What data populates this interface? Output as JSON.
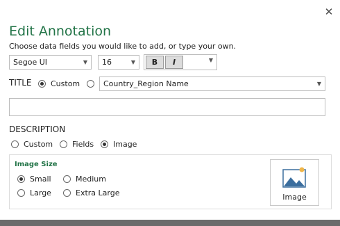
{
  "dialog": {
    "title": "Edit Annotation",
    "subtitle": "Choose data fields you would like to add, or type your own.",
    "close_glyph": "✕"
  },
  "font": {
    "family_value": "Segoe UI",
    "size_value": "16",
    "bold_label": "B",
    "italic_label": "I"
  },
  "title_section": {
    "label": "TITLE",
    "options": [
      "Custom",
      ""
    ],
    "selected": "Custom",
    "field_value": "Country_Region Name",
    "text_value": ""
  },
  "description": {
    "label": "DESCRIPTION",
    "options": [
      "Custom",
      "Fields",
      "Image"
    ],
    "selected": "Image"
  },
  "image_size": {
    "title": "Image Size",
    "options": [
      "Small",
      "Medium",
      "Large",
      "Extra Large"
    ],
    "selected": "Small",
    "image_button_label": "Image",
    "image_icon": "image-icon"
  },
  "colors": {
    "accent": "#217346"
  }
}
